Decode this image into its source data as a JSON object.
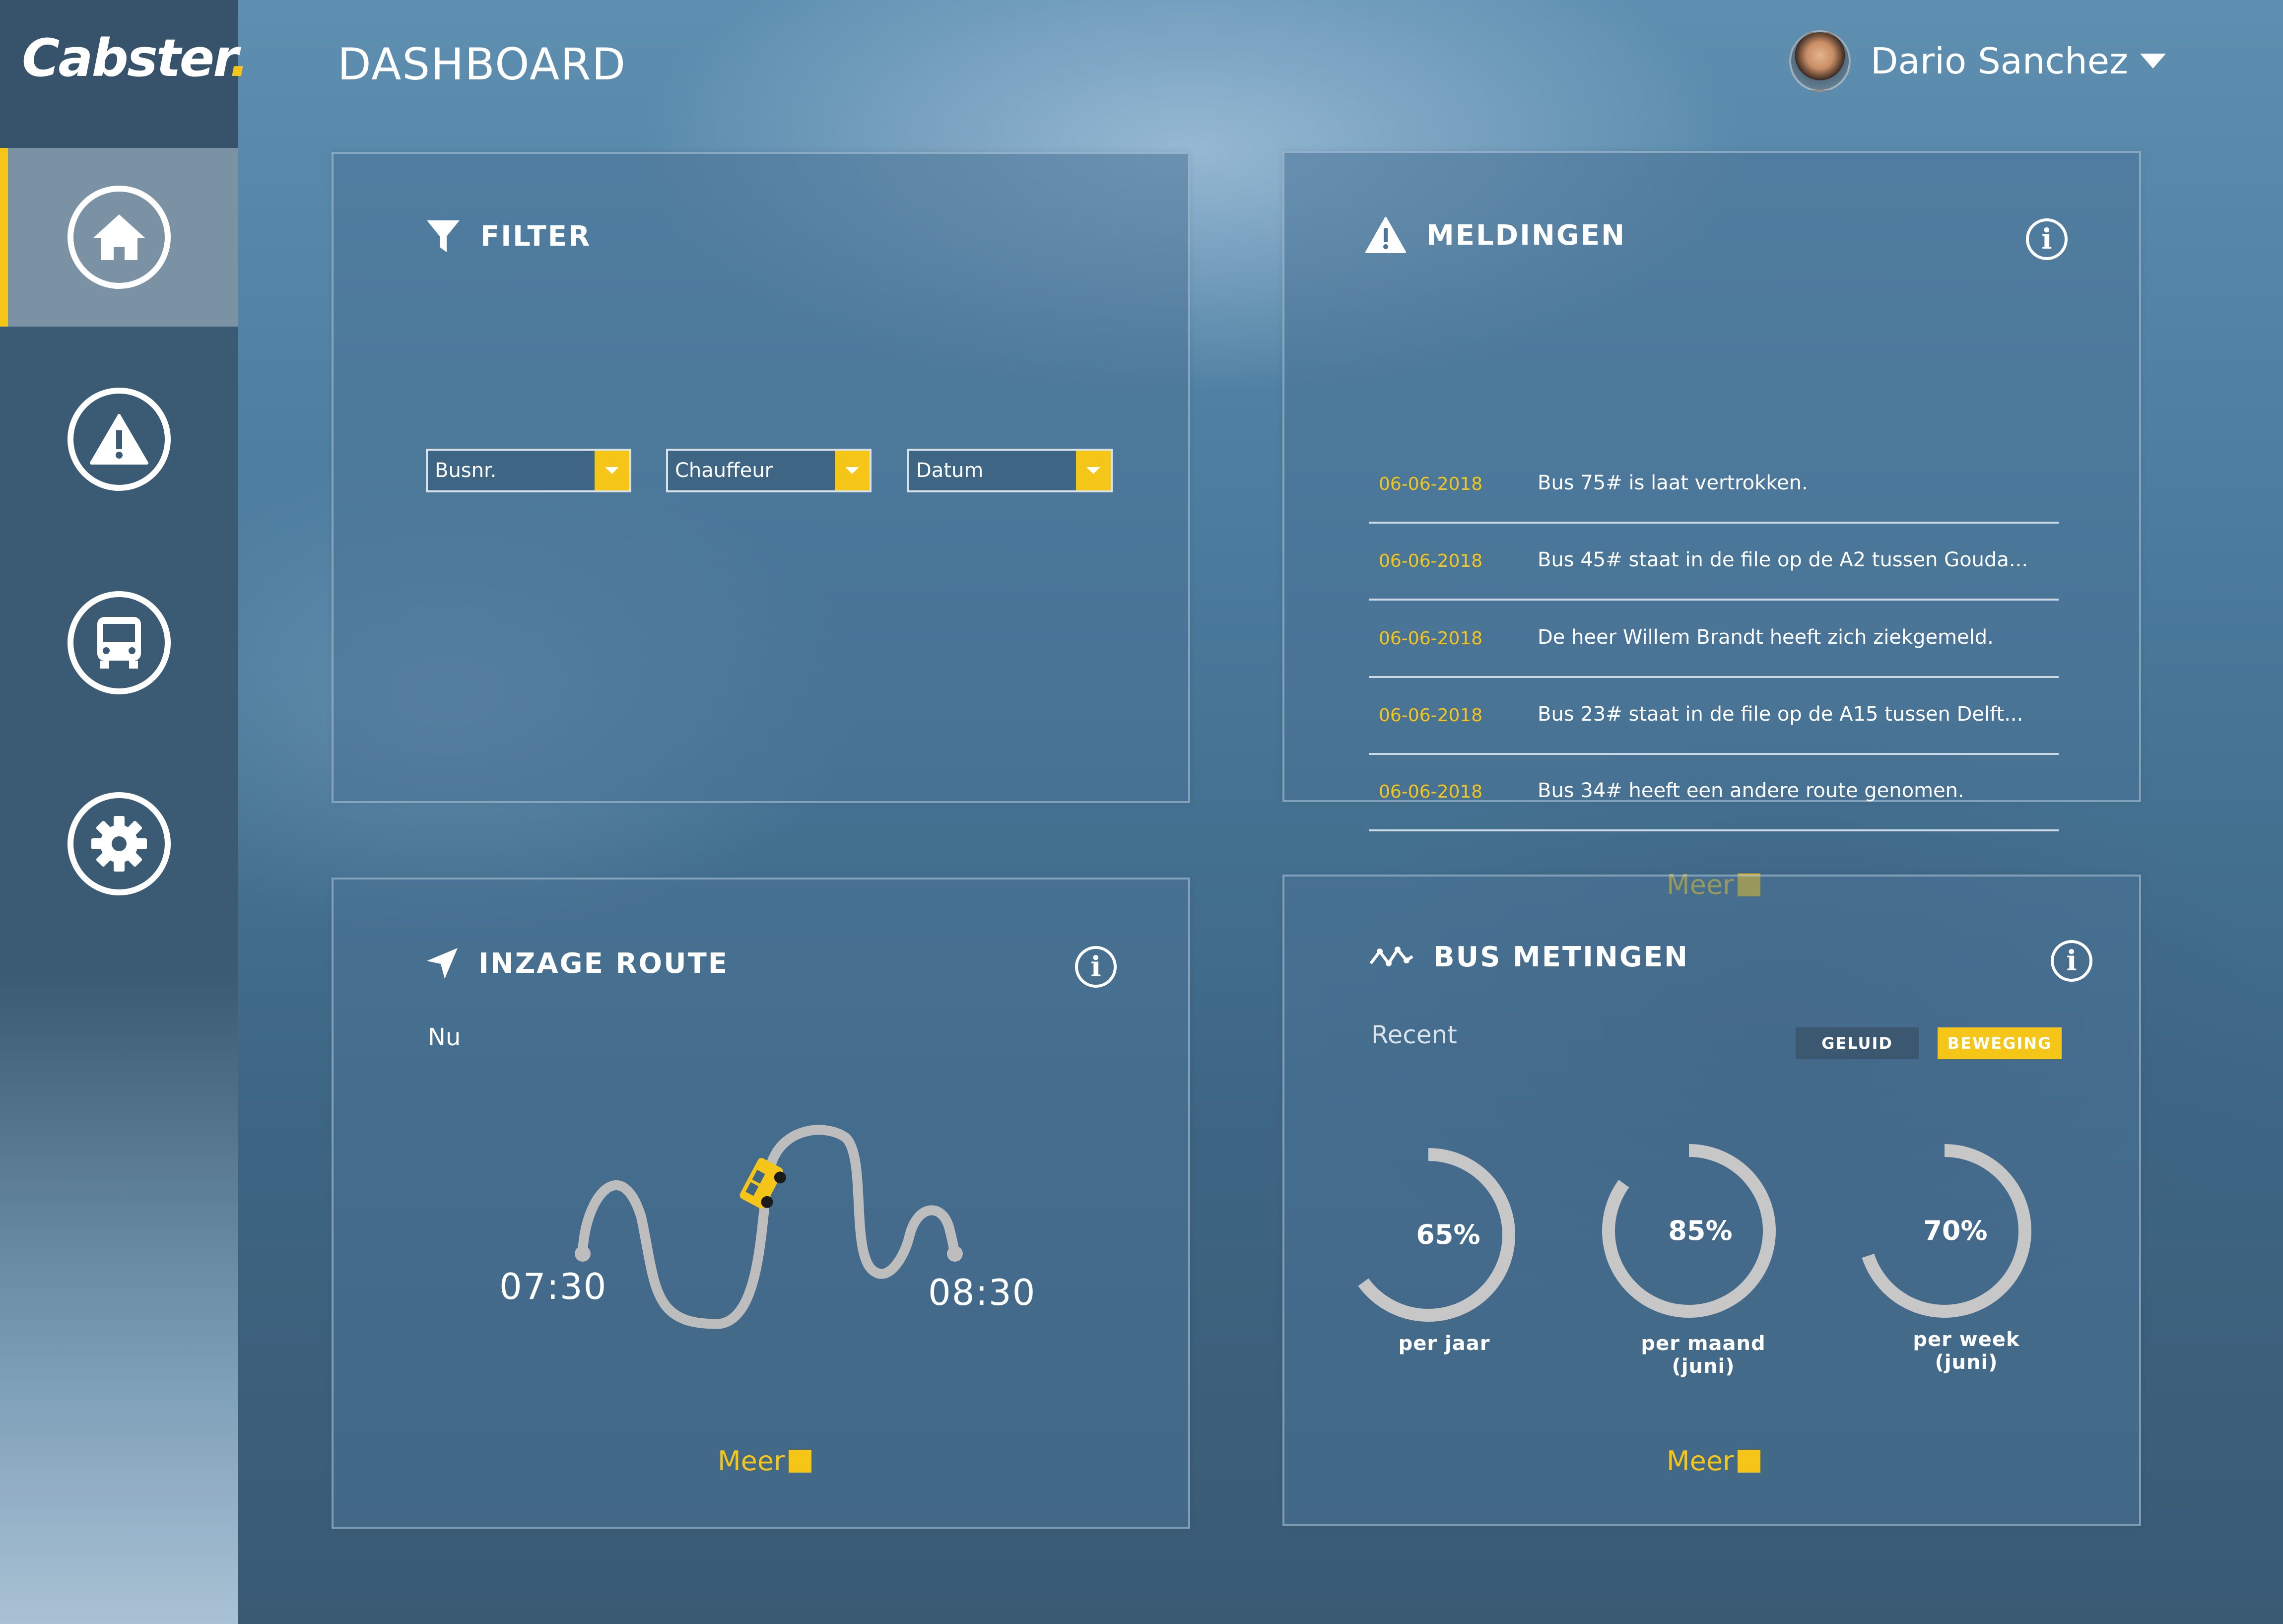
{
  "app": {
    "logo_text": "Cabster",
    "logo_dot": "."
  },
  "header": {
    "title": "DASHBOARD",
    "user_name": "Dario Sanchez"
  },
  "sidebar": {
    "items": [
      {
        "name": "home",
        "icon": "home-icon",
        "active": true
      },
      {
        "name": "alerts",
        "icon": "warning-icon",
        "active": false
      },
      {
        "name": "bus",
        "icon": "bus-icon",
        "active": false
      },
      {
        "name": "settings",
        "icon": "gear-icon",
        "active": false
      }
    ]
  },
  "filter": {
    "title": "FILTER",
    "selects": [
      {
        "value": "Busnr."
      },
      {
        "value": "Chauffeur"
      },
      {
        "value": "Datum"
      }
    ]
  },
  "meldingen": {
    "title": "MELDINGEN",
    "items": [
      {
        "date": "06-06-2018",
        "text": "Bus 75# is laat vertrokken."
      },
      {
        "date": "06-06-2018",
        "text": "Bus 45# staat in de file op de A2 tussen Gouda..."
      },
      {
        "date": "06-06-2018",
        "text": "De heer Willem Brandt heeft zich ziekgemeld."
      },
      {
        "date": "06-06-2018",
        "text": "Bus 23# staat in de file op de A15 tussen Delft..."
      },
      {
        "date": "06-06-2018",
        "text": "Bus 34# heeft een andere route genomen."
      }
    ],
    "more": "Meer"
  },
  "route": {
    "title": "INZAGE ROUTE",
    "now_label": "Nu",
    "start_time": "07:30",
    "end_time": "08:30",
    "more": "Meer"
  },
  "metingen": {
    "title": "BUS METINGEN",
    "recent_label": "Recent",
    "tags": {
      "geluid": "GELUID",
      "beweging": "BEWEGING"
    },
    "gauges": [
      {
        "value": "65%",
        "fraction": 0.65,
        "label_line1": "per jaar",
        "label_line2": ""
      },
      {
        "value": "85%",
        "fraction": 0.85,
        "label_line1": "per  maand",
        "label_line2": "(juni)"
      },
      {
        "value": "70%",
        "fraction": 0.7,
        "label_line1": "per week",
        "label_line2": "(juni)"
      }
    ],
    "more": "Meer"
  },
  "colors": {
    "accent": "#f5c518",
    "sidebar": "#3b5a73",
    "gauge": "#c7c7c7"
  }
}
